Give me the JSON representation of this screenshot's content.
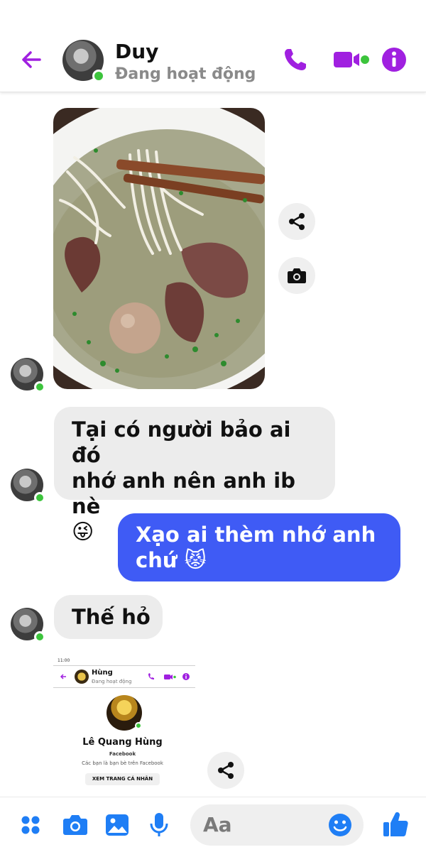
{
  "header": {
    "contact_name": "Duy",
    "status": "Đang hoạt động",
    "icons": [
      "back-arrow-icon",
      "phone-icon",
      "video-icon",
      "info-icon"
    ],
    "accent_color": "#a020e0",
    "online_color": "#3cc43c"
  },
  "messages": [
    {
      "type": "image",
      "from": "contact",
      "subject": "noodle-soup-photo"
    },
    {
      "type": "text",
      "from": "contact",
      "line1": "Tại có người bảo ai đó",
      "line2": "nhớ anh nên anh ib nè",
      "emoji": "😜"
    },
    {
      "type": "text",
      "from": "me",
      "line1": "Xạo ai thèm nhớ anh",
      "line2": "chứ",
      "emoji": "😾"
    },
    {
      "type": "text",
      "from": "contact",
      "line1": "Thế hỏ"
    },
    {
      "type": "image",
      "from": "contact",
      "subject": "profile-screenshot"
    }
  ],
  "shared_screenshot": {
    "time": "11:00",
    "name": "Hùng",
    "status": "Đang hoạt động",
    "profile_name": "Lê Quang Hùng",
    "network": "Facebook",
    "subtitle": "Các bạn là bạn bè trên Facebook",
    "button": "XEM TRANG CÁ NHÂN"
  },
  "composer": {
    "placeholder": "Aa",
    "icons": [
      "menu-grid-icon",
      "camera-icon",
      "gallery-icon",
      "microphone-icon",
      "emoji-icon",
      "like-icon"
    ],
    "accent_color": "#1f7ef5"
  }
}
